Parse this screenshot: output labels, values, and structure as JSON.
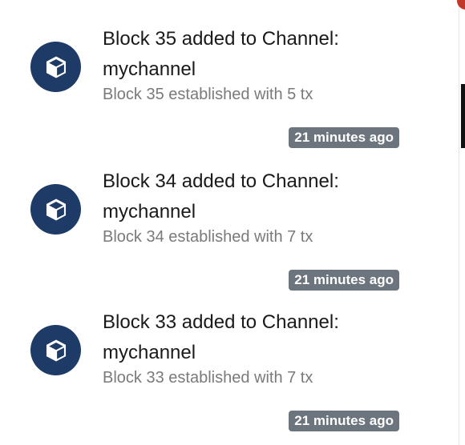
{
  "notifications": [
    {
      "title": "Block 35 added to Channel: mychannel",
      "description": "Block 35 established with 5 tx",
      "time": "21 minutes ago",
      "icon": "cube-icon"
    },
    {
      "title": "Block 34 added to Channel: mychannel",
      "description": "Block 34 established with 7 tx",
      "time": "21 minutes ago",
      "icon": "cube-icon"
    },
    {
      "title": "Block 33 added to Channel: mychannel",
      "description": "Block 33 established with 7 tx",
      "time": "21 minutes ago",
      "icon": "cube-icon"
    }
  ],
  "colors": {
    "avatar_bg": "#1e3a66",
    "badge_bg": "#6c757d"
  }
}
